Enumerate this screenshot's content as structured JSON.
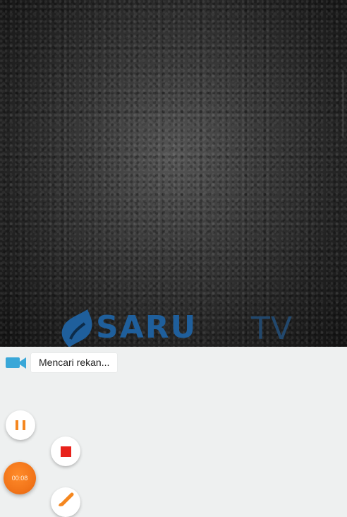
{
  "video": {
    "watermark_brand": "SARU",
    "watermark_suffix": "TV"
  },
  "status": {
    "text": "Mencari rekan..."
  },
  "controls": {
    "timer": "00:08",
    "pause_icon": "pause-icon",
    "stop_icon": "stop-icon",
    "brush_icon": "brush-icon",
    "camera_icon": "video-camera-icon"
  },
  "colors": {
    "accent": "#f5871f",
    "stop": "#e8221b",
    "brand_blue": "#1f5f9c",
    "camera_blue": "#39a7d8"
  }
}
